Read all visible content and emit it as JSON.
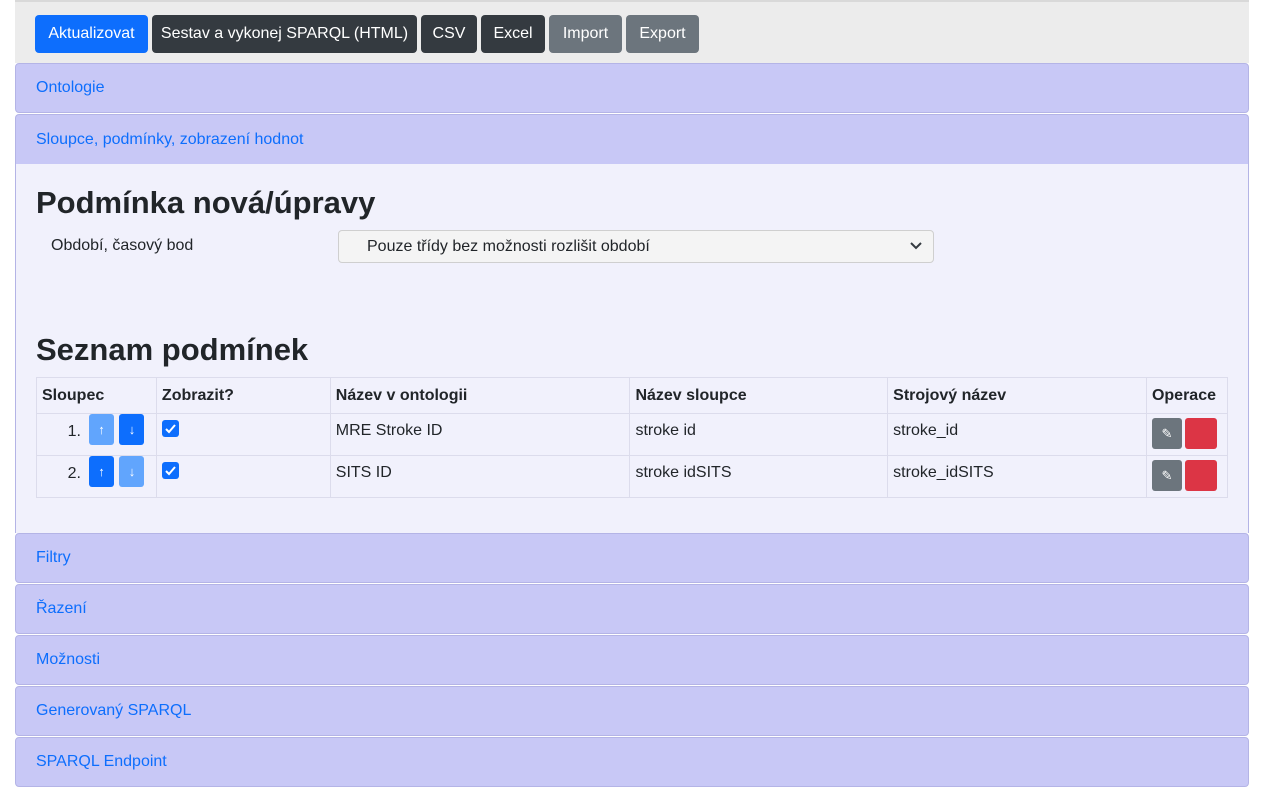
{
  "toolbar": {
    "update": "Aktualizovat",
    "build_run": "Sestav a vykonej SPARQL (HTML)",
    "csv": "CSV",
    "excel": "Excel",
    "import": "Import",
    "export": "Export"
  },
  "sections": {
    "ontologie": "Ontologie",
    "sloupce": "Sloupce, podmínky, zobrazení hodnot",
    "filtry": "Filtry",
    "razeni": "Řazení",
    "moznosti": "Možnosti",
    "generovany": "Generovaný SPARQL",
    "endpoint": "SPARQL Endpoint"
  },
  "condition_form": {
    "heading": "Podmínka nová/úpravy",
    "period_label": "Období, časový bod",
    "period_value": "Pouze třídy bez možnosti rozlišit období"
  },
  "conditions_list": {
    "heading": "Seznam podmínek",
    "columns": [
      "Sloupec",
      "Zobrazit?",
      "Název v ontologii",
      "Název sloupce",
      "Strojový název",
      "Operace"
    ],
    "rows": [
      {
        "num": "1.",
        "show": true,
        "ontology_name": "MRE Stroke ID",
        "column_name": "stroke id",
        "machine_name": "stroke_id"
      },
      {
        "num": "2.",
        "show": true,
        "ontology_name": "SITS ID",
        "column_name": "stroke idSITS",
        "machine_name": "stroke_idSITS"
      }
    ],
    "icons": {
      "up": "↑",
      "down": "↓",
      "edit": "✎"
    }
  },
  "colors": {
    "accent": "#0d6efd",
    "section_bg": "#c8c8f6",
    "delete": "#dc3545"
  }
}
